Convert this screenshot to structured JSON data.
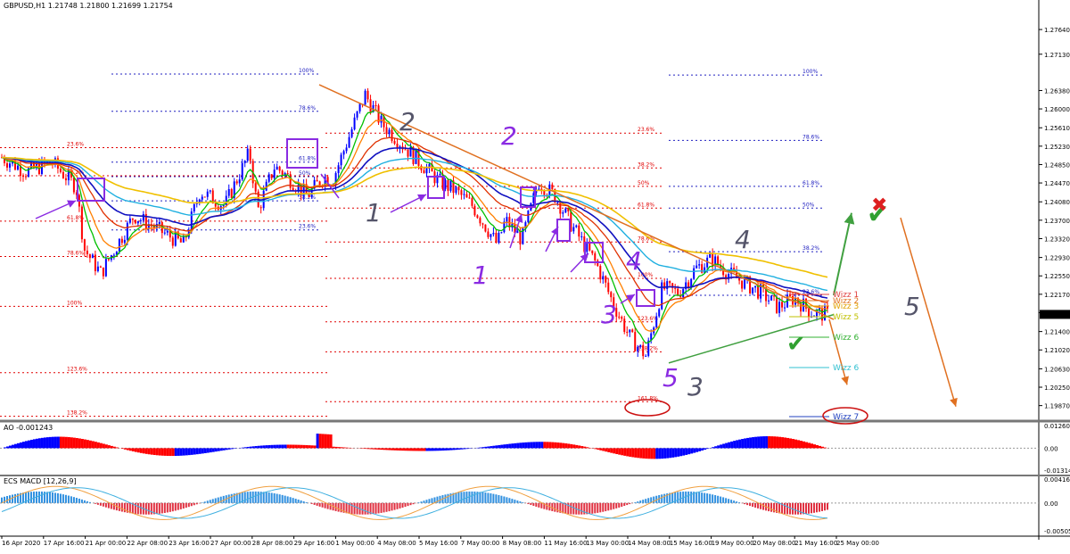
{
  "symbol_info": "GBPUSD,H1  1.21748 1.21800 1.21699 1.21754",
  "current_price": "1.21754",
  "colors": {
    "price_up": "#0000ff",
    "price_down": "#ff0000",
    "ema_green": "#00c000",
    "ema_orange": "#ff8000",
    "ema_red": "#e03000",
    "ema_blue": "#1010c0",
    "ema_cyan": "#20b0e0",
    "ema_gold": "#f0c000",
    "wave_purple": "#8a2be2",
    "wave_grey": "#505060",
    "trend_orange": "#e07020",
    "trend_green": "#40a040",
    "fib_red": "#e00000",
    "fib_blue": "#2020c0",
    "ao_up": "#0000ff",
    "ao_down": "#ff0000",
    "macd_up": "#3090e0",
    "macd_down": "#e03040",
    "macd_signal1": "#f0a040",
    "macd_signal2": "#40b0e0"
  },
  "chart_data": [
    {
      "type": "candlestick",
      "name": "GBPUSD,H1",
      "ylim": [
        1.1955,
        1.2825
      ],
      "y_ticks": [
        "1.27640",
        "1.27130",
        "1.26380",
        "1.26000",
        "1.25610",
        "1.25230",
        "1.24850",
        "1.24470",
        "1.24080",
        "1.23700",
        "1.23320",
        "1.22930",
        "1.22550",
        "1.22170",
        "1.21790",
        "1.21400",
        "1.21020",
        "1.20630",
        "1.20250",
        "1.19870"
      ],
      "x_ticks": [
        "16 Apr 2020",
        "17 Apr 16:00",
        "21 Apr 00:00",
        "22 Apr 08:00",
        "23 Apr 16:00",
        "27 Apr 00:00",
        "28 Apr 08:00",
        "29 Apr 16:00",
        "1 May 00:00",
        "4 May 08:00",
        "5 May 16:00",
        "7 May 00:00",
        "8 May 08:00",
        "11 May 16:00",
        "13 May 00:00",
        "14 May 08:00",
        "15 May 16:00",
        "19 May 00:00",
        "20 May 08:00",
        "21 May 16:00",
        "25 May 00:00"
      ],
      "price_path_x": [
        0,
        0.03,
        0.06,
        0.09,
        0.1,
        0.12,
        0.16,
        0.19,
        0.22,
        0.24,
        0.27,
        0.3,
        0.31,
        0.33,
        0.34,
        0.37,
        0.39,
        0.4,
        0.44,
        0.46,
        0.5,
        0.53,
        0.55,
        0.57,
        0.6,
        0.61,
        0.63,
        0.65,
        0.67,
        0.69,
        0.72,
        0.74,
        0.76,
        0.78,
        0.8,
        0.82,
        0.84,
        0.86,
        0.88,
        0.9,
        0.92,
        0.94,
        0.96,
        0.98,
        1.0
      ],
      "price_path_y": [
        1.25,
        1.247,
        1.249,
        1.244,
        1.231,
        1.226,
        1.238,
        1.235,
        1.232,
        1.243,
        1.24,
        1.251,
        1.239,
        1.248,
        1.247,
        1.242,
        1.246,
        1.245,
        1.263,
        1.257,
        1.25,
        1.245,
        1.243,
        1.24,
        1.232,
        1.237,
        1.233,
        1.245,
        1.242,
        1.236,
        1.228,
        1.22,
        1.213,
        1.209,
        1.223,
        1.222,
        1.227,
        1.229,
        1.226,
        1.224,
        1.222,
        1.219,
        1.221,
        1.218,
        1.2175
      ]
    },
    {
      "type": "bar",
      "name": "AO",
      "title": "AO -0.001243",
      "ylim": [
        -0.013141,
        0.012602
      ],
      "y_ticks": [
        "0.012602",
        "0.00",
        "-0.013141"
      ]
    },
    {
      "type": "bar",
      "name": "ECS MACD",
      "title": "ECS MACD [12,26,9]",
      "ylim": [
        -0.005053,
        0.004169
      ],
      "y_ticks": [
        "0.0041692",
        "0.00",
        "-0.0050531"
      ]
    }
  ],
  "fib_levels": {
    "left_red": [
      "23.6%",
      "38.2%",
      "61.8%",
      "78.6%",
      "100%",
      "123.6%",
      "138.2%"
    ],
    "middle_top": [
      "100%",
      "78.6%",
      "61.8%",
      "50%",
      "38.2%",
      "23.6%"
    ],
    "middle_red": [
      "23.6%",
      "38.2%",
      "50%",
      "61.8%",
      "78.6%",
      "100%",
      "123.6%",
      "138.2%",
      "161.8%"
    ],
    "right_blue": [
      "100%",
      "78.6%",
      "61.8%",
      "50%",
      "38.2%",
      "23.6%"
    ]
  },
  "wave_labels": [
    "1",
    "2",
    "1",
    "2",
    "1",
    "3",
    "4",
    "5",
    "3",
    "4",
    "2",
    "5"
  ],
  "wizz_labels": [
    "Wizz 1",
    "Wizz 2",
    "Wizz 3",
    "Wizz 5",
    "Wizz 6",
    "Wizz 6",
    "Wizz 7"
  ],
  "markers": {
    "check": "✔",
    "cross": "✖"
  }
}
